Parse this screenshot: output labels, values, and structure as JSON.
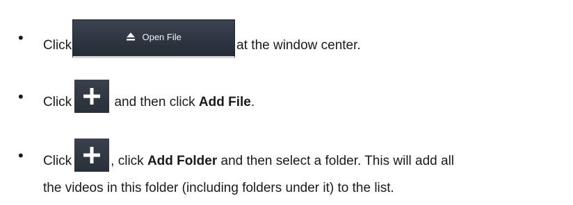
{
  "items": [
    {
      "lead": "Click",
      "button": {
        "label": "Open File",
        "icon": "eject-icon"
      },
      "tail": "at the window center."
    },
    {
      "lead": "Click",
      "button": {
        "icon": "plus-icon"
      },
      "mid": "and then click",
      "bold": "Add File",
      "tail": "."
    },
    {
      "lead": "Click",
      "button": {
        "icon": "plus-icon"
      },
      "mid": ", click",
      "bold": "Add Folder",
      "tail": "and then select a folder. This will add all",
      "continuation": "the videos in this folder (including folders under it) to the list."
    }
  ],
  "bullet_char": "•",
  "colors": {
    "button_bg": "#2d333d",
    "button_text": "#f2f4f7",
    "text": "#1a1a1a"
  }
}
